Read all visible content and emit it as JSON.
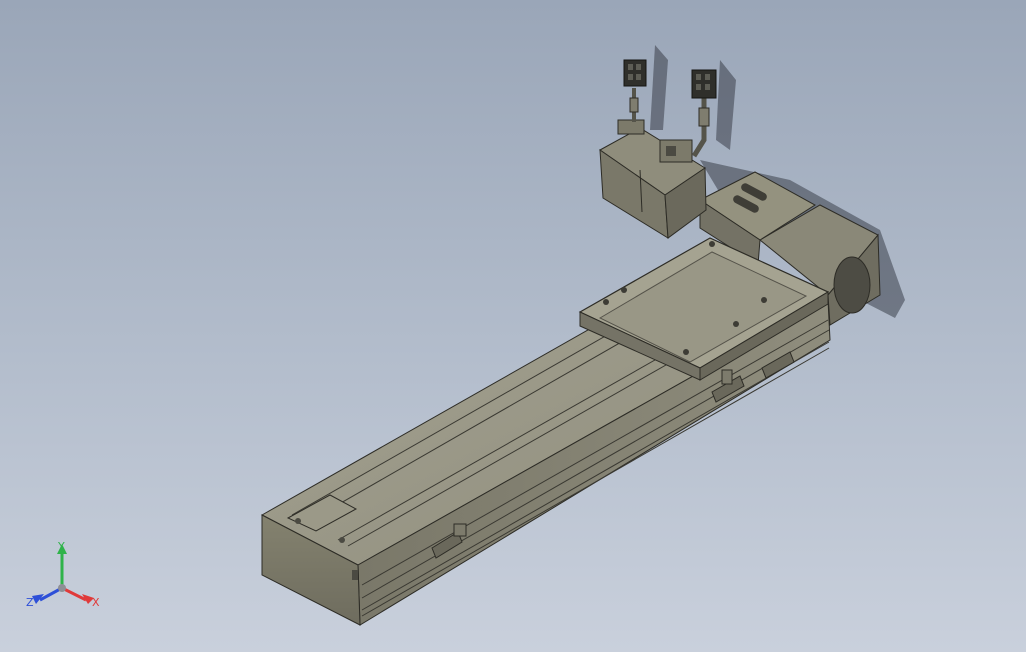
{
  "viewport": {
    "background_top": "#9aa6b8",
    "background_bottom": "#c9d0dc"
  },
  "model": {
    "name": "linear-actuator-with-folded-motor",
    "body_color": "#8e8c7c",
    "dark_color": "#5f5d52",
    "light_color": "#a9a795"
  },
  "triad": {
    "x_label": "X",
    "y_label": "Y",
    "z_label": "Z",
    "x_color": "#e03a3a",
    "y_color": "#2fb34a",
    "z_color": "#2d4fd8"
  }
}
